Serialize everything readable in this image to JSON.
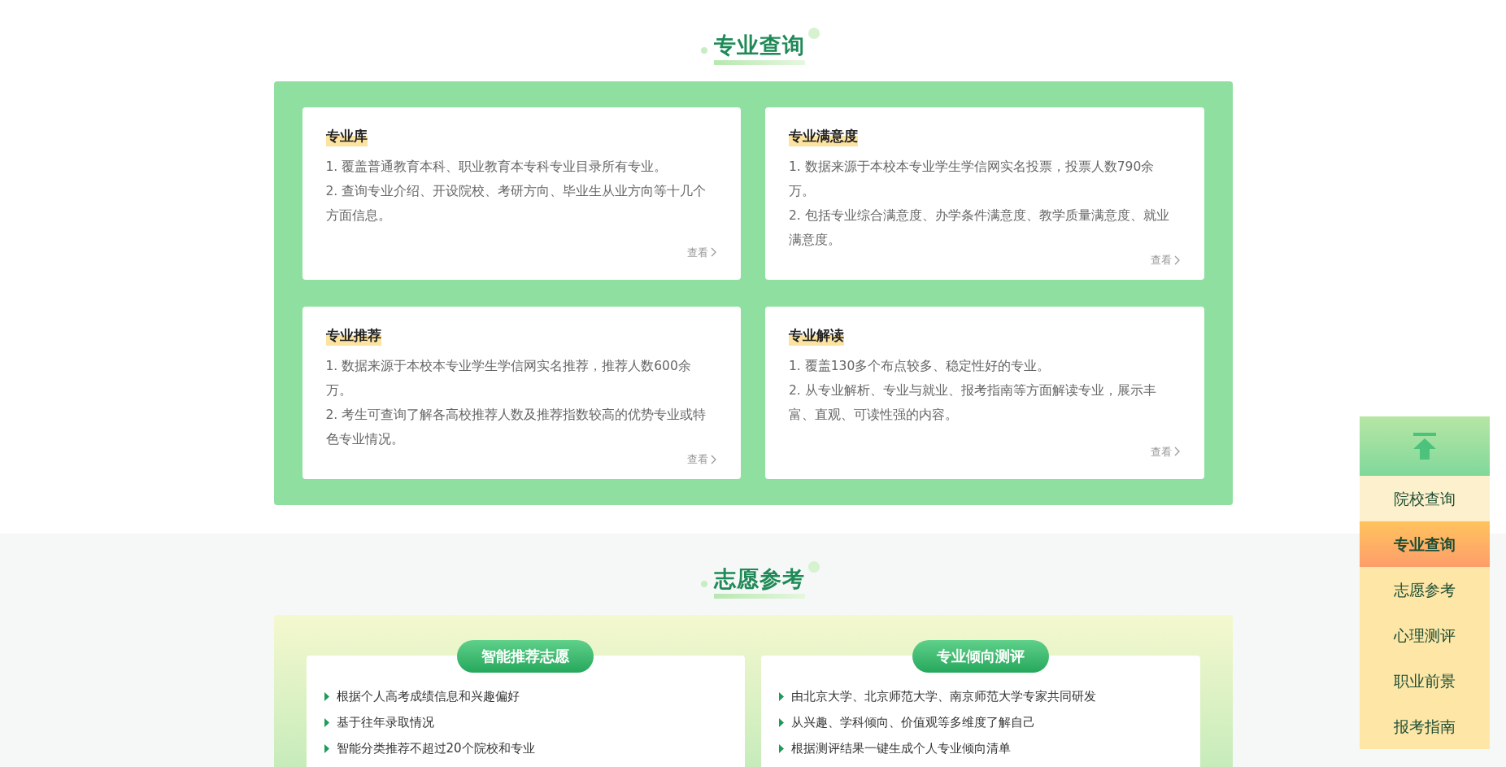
{
  "major_section": {
    "title": "专业查询",
    "cards": [
      {
        "title": "专业库",
        "lines": [
          "1. 覆盖普通教育本科、职业教育本专科专业目录所有专业。",
          "2. 查询专业介绍、开设院校、考研方向、毕业生从业方向等十几个方面信息。"
        ],
        "link": "查看"
      },
      {
        "title": "专业满意度",
        "lines": [
          "1. 数据来源于本校本专业学生学信网实名投票，投票人数790余万。",
          "2. 包括专业综合满意度、办学条件满意度、教学质量满意度、就业满意度。"
        ],
        "link": "查看"
      },
      {
        "title": "专业推荐",
        "lines": [
          "1. 数据来源于本校本专业学生学信网实名推荐，推荐人数600余万。",
          "2. 考生可查询了解各高校推荐人数及推荐指数较高的优势专业或特色专业情况。"
        ],
        "link": "查看"
      },
      {
        "title": "专业解读",
        "lines": [
          "1. 覆盖130多个布点较多、稳定性好的专业。",
          "2. 从专业解析、专业与就业、报考指南等方面解读专业，展示丰富、直观、可读性强的内容。"
        ],
        "link": "查看"
      }
    ]
  },
  "volunteer_section": {
    "title": "志愿参考",
    "cards": [
      {
        "badge": "智能推荐志愿",
        "bullets": [
          "根据个人高考成绩信息和兴趣偏好",
          "基于往年录取情况",
          "智能分类推荐不超过20个院校和专业"
        ]
      },
      {
        "badge": "专业倾向测评",
        "bullets": [
          "由北京大学、北京师范大学、南京师范大学专家共同研发",
          "从兴趣、学科倾向、价值观等多维度了解自己",
          "根据测评结果一键生成个人专业倾向清单"
        ]
      }
    ]
  },
  "sidebar": {
    "items": [
      {
        "label": "院校查询",
        "selected": false
      },
      {
        "label": "专业查询",
        "selected": true
      },
      {
        "label": "志愿参考",
        "selected": false
      },
      {
        "label": "心理测评",
        "selected": false
      },
      {
        "label": "职业前景",
        "selected": false
      },
      {
        "label": "报考指南",
        "selected": false
      }
    ]
  }
}
